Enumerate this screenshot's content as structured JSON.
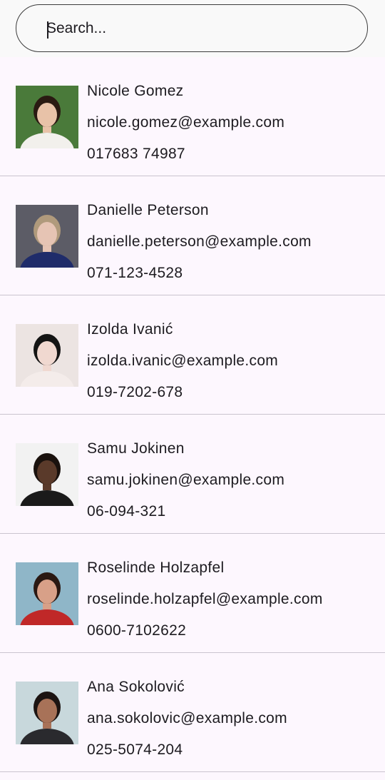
{
  "search": {
    "placeholder": "Search...",
    "value": ""
  },
  "contacts": [
    {
      "name": "Nicole Gomez",
      "email": "nicole.gomez@example.com",
      "phone": "017683 74987",
      "avatar_icon": "portrait-photo",
      "colors": {
        "bg": "#4a7a3a",
        "skin": "#e8c2a8",
        "hair": "#2a1a12",
        "shirt": "#f2f0ec"
      }
    },
    {
      "name": "Danielle Peterson",
      "email": "danielle.peterson@example.com",
      "phone": "071-123-4528",
      "avatar_icon": "portrait-photo",
      "colors": {
        "bg": "#5c5c66",
        "skin": "#e6c4b4",
        "hair": "#b09a7c",
        "shirt": "#1f2c6a"
      }
    },
    {
      "name": "Izolda Ivanić",
      "email": "izolda.ivanic@example.com",
      "phone": "019-7202-678",
      "avatar_icon": "portrait-photo",
      "colors": {
        "bg": "#ece4e2",
        "skin": "#f0d8d0",
        "hair": "#141414",
        "shirt": "#f4ecea"
      }
    },
    {
      "name": "Samu Jokinen",
      "email": "samu.jokinen@example.com",
      "phone": "06-094-321",
      "avatar_icon": "portrait-photo",
      "colors": {
        "bg": "#f2f2f2",
        "skin": "#5a3a2a",
        "hair": "#1a120e",
        "shirt": "#1a1a1a"
      }
    },
    {
      "name": "Roselinde Holzapfel",
      "email": "roselinde.holzapfel@example.com",
      "phone": "0600-7102622",
      "avatar_icon": "portrait-photo",
      "colors": {
        "bg": "#8fb6c8",
        "skin": "#d8a088",
        "hair": "#2a1812",
        "shirt": "#c02828"
      }
    },
    {
      "name": "Ana Sokolović",
      "email": "ana.sokolovic@example.com",
      "phone": "025-5074-204",
      "avatar_icon": "portrait-photo",
      "colors": {
        "bg": "#c8d8dc",
        "skin": "#a87258",
        "hair": "#1c1412",
        "shirt": "#2a2a2e"
      }
    }
  ]
}
